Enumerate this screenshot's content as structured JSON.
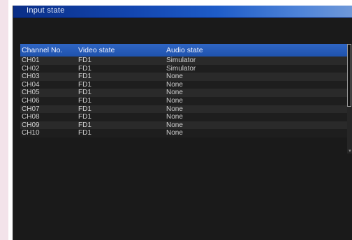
{
  "window": {
    "title": "Input state"
  },
  "table": {
    "headers": [
      "Channel No.",
      "Video state",
      "Audio state"
    ],
    "rows": [
      [
        "CH01",
        "FD1",
        "Simulator"
      ],
      [
        "CH02",
        "FD1",
        "Simulator"
      ],
      [
        "CH03",
        "FD1",
        "None"
      ],
      [
        "CH04",
        "FD1",
        "None"
      ],
      [
        "CH05",
        "FD1",
        "None"
      ],
      [
        "CH06",
        "FD1",
        "None"
      ],
      [
        "CH07",
        "FD1",
        "None"
      ],
      [
        "CH08",
        "FD1",
        "None"
      ],
      [
        "CH09",
        "FD1",
        "None"
      ],
      [
        "CH10",
        "FD1",
        "None"
      ]
    ]
  },
  "colors": {
    "titlebar": "#1346b0",
    "header": "#2f66c4",
    "background": "#1a1a1a"
  }
}
